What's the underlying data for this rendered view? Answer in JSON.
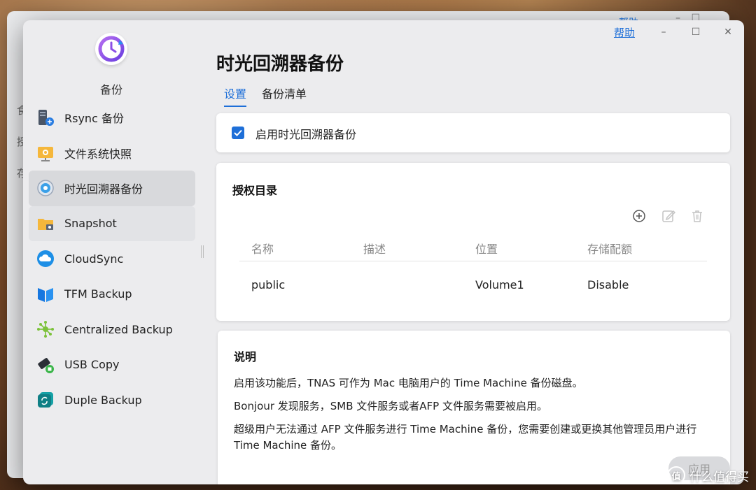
{
  "window": {
    "help_label": "帮助",
    "minimize_glyph": "–",
    "maximize_glyph": "☐",
    "close_glyph": "✕"
  },
  "background_window": {
    "help_label": "帮助",
    "side_chars": [
      "食",
      "授",
      "存"
    ]
  },
  "sidebar": {
    "app_title": "备份",
    "items": [
      {
        "label": "Rsync 备份",
        "icon": "rsync-server-icon"
      },
      {
        "label": "文件系统快照",
        "icon": "filesystem-snapshot-icon"
      },
      {
        "label": "时光回溯器备份",
        "icon": "time-machine-icon",
        "active": true
      },
      {
        "label": "Snapshot",
        "icon": "snapshot-folder-icon"
      },
      {
        "label": "CloudSync",
        "icon": "cloud-sync-icon"
      },
      {
        "label": "TFM Backup",
        "icon": "tfm-backup-icon"
      },
      {
        "label": "Centralized Backup",
        "icon": "centralized-backup-icon"
      },
      {
        "label": "USB Copy",
        "icon": "usb-copy-icon"
      },
      {
        "label": "Duple Backup",
        "icon": "duple-backup-icon"
      }
    ]
  },
  "main": {
    "title": "时光回溯器备份",
    "tabs": [
      {
        "label": "设置",
        "active": true
      },
      {
        "label": "备份清单",
        "active": false
      }
    ],
    "enable": {
      "label": "启用时光回溯器备份",
      "checked": true
    },
    "authorized_dirs": {
      "heading": "授权目录",
      "columns": [
        "名称",
        "描述",
        "位置",
        "存储配额"
      ],
      "rows": [
        {
          "name": "public",
          "description": "",
          "location": "Volume1",
          "quota": "Disable"
        }
      ]
    },
    "info": {
      "heading": "说明",
      "lines": [
        "启用该功能后，TNAS 可作为 Mac 电脑用户的 Time Machine 备份磁盘。",
        "Bonjour 发现服务，SMB 文件服务或者AFP 文件服务需要被启用。",
        "超级用户无法通过 AFP 文件服务进行 Time Machine 备份，您需要创建或更换其他管理员用户进行 Time Machine 备份。"
      ]
    },
    "apply_label": "应用"
  },
  "watermark": {
    "icon_glyph": "值",
    "text": "什么值得买"
  },
  "colors": {
    "accent": "#1e6fd8",
    "sidebar_active": "#d8d9dc",
    "window_bg": "#ececee"
  }
}
